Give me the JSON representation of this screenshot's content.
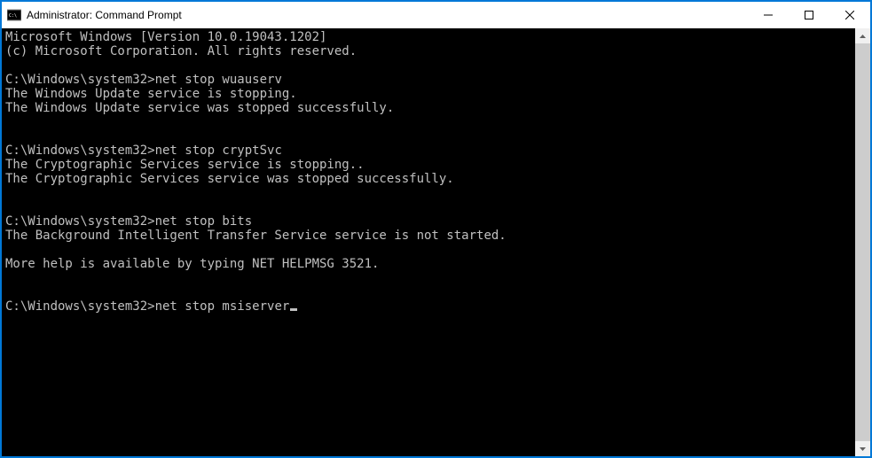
{
  "window": {
    "title": "Administrator: Command Prompt"
  },
  "terminal": {
    "header0": "Microsoft Windows [Version 10.0.19043.1202]",
    "header1": "(c) Microsoft Corporation. All rights reserved.",
    "blank": "",
    "prompt": "C:\\Windows\\system32>",
    "cmd0": "net stop wuauserv",
    "out0a": "The Windows Update service is stopping.",
    "out0b": "The Windows Update service was stopped successfully.",
    "cmd1": "net stop cryptSvc",
    "out1a": "The Cryptographic Services service is stopping..",
    "out1b": "The Cryptographic Services service was stopped successfully.",
    "cmd2": "net stop bits",
    "out2a": "The Background Intelligent Transfer Service service is not started.",
    "out2b": "More help is available by typing NET HELPMSG 3521.",
    "cmd3": "net stop msiserver"
  }
}
